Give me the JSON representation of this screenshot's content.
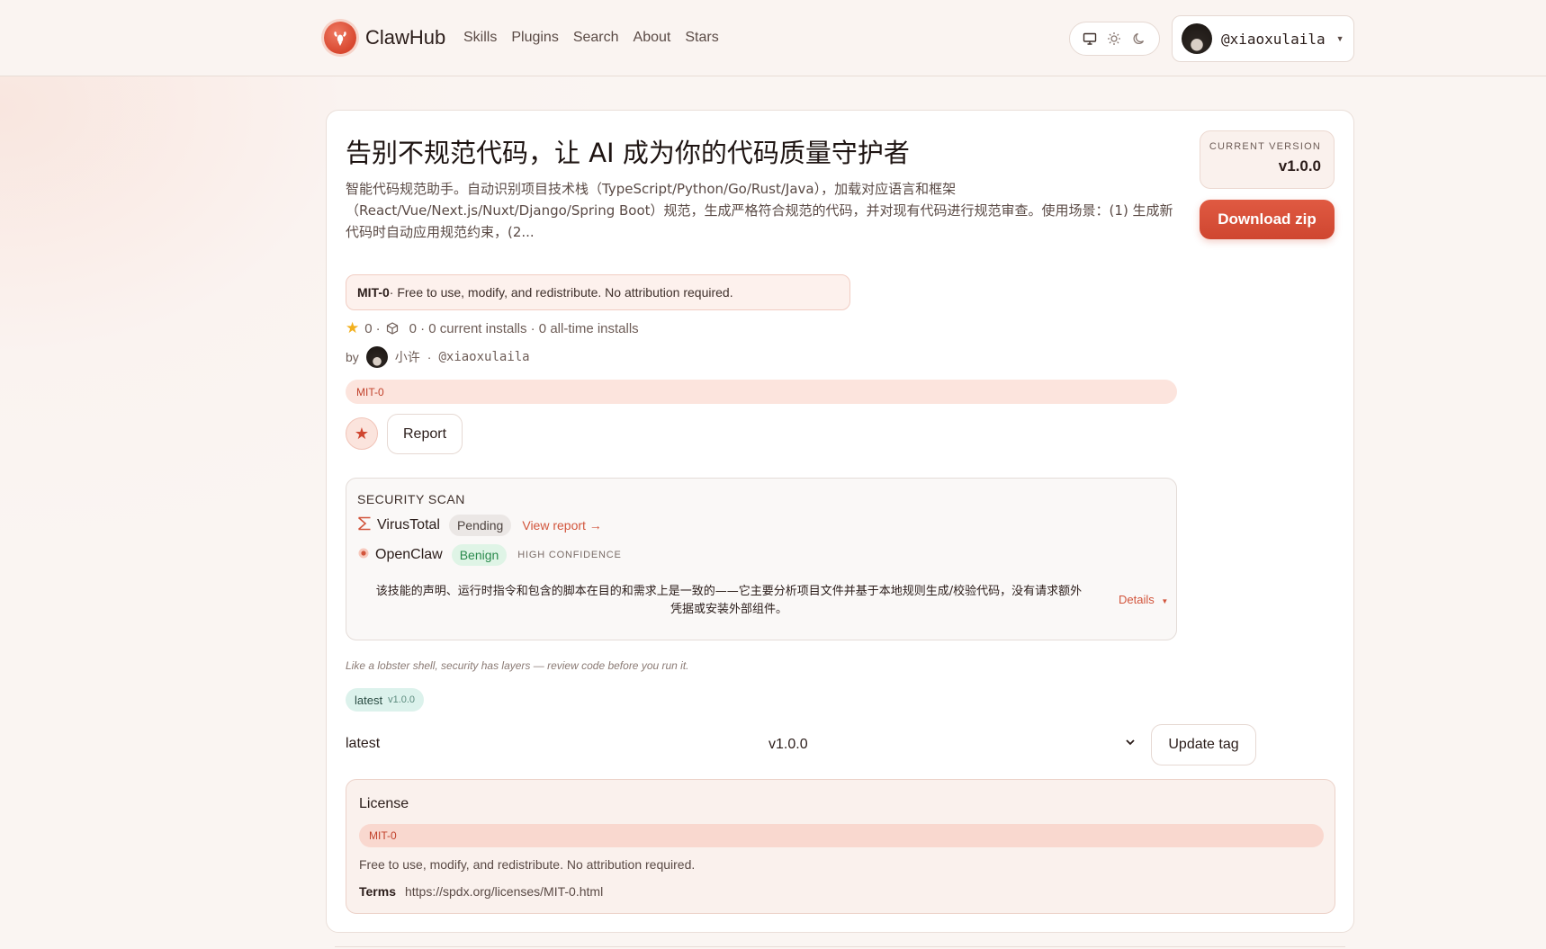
{
  "header": {
    "brand": "ClawHub",
    "nav": [
      "Skills",
      "Plugins",
      "Search",
      "About",
      "Stars"
    ],
    "user_handle": "@xiaoxulaila"
  },
  "skill": {
    "title": "告别不规范代码，让 AI 成为你的代码质量守护者",
    "summary": "智能代码规范助手。自动识别项目技术栈（TypeScript/Python/Go/Rust/Java），加载对应语言和框架（React/Vue/Next.js/Nuxt/Django/Spring Boot）规范，生成严格符合规范的代码，并对现有代码进行规范审查。使用场景：(1) 生成新代码时自动应用规范约束，(2...",
    "version_label": "CURRENT VERSION",
    "version": "v1.0.0",
    "download_label": "Download zip",
    "license_banner": {
      "id": "MIT-0",
      "text": " · Free to use, modify, and redistribute. No attribution required."
    },
    "stats": {
      "stars": "0",
      "stars_sep": "·",
      "installs": "0 · 0 current installs · 0 all-time installs"
    },
    "byline": {
      "by": "by",
      "author_name": "小许",
      "sep": "·",
      "author_handle": "@xiaoxulaila"
    },
    "license_pill": "MIT-0",
    "report_label": "Report"
  },
  "security_scan": {
    "title": "SECURITY SCAN",
    "virustotal": {
      "name": "VirusTotal",
      "status": "Pending",
      "link": "View report →"
    },
    "openclaw": {
      "name": "OpenClaw",
      "status": "Benign",
      "confidence": "HIGH CONFIDENCE"
    },
    "description": "该技能的声明、运行时指令和包含的脚本在目的和需求上是一致的——它主要分析项目文件并基于本地规则生成/校验代码，没有请求额外凭据或安装外部组件。",
    "details_label": "Details"
  },
  "tagline": "Like a lobster shell, security has layers — review code before you run it.",
  "tags": {
    "chip_name": "latest",
    "chip_version": "v1.0.0",
    "row_name": "latest",
    "selected_version": "v1.0.0",
    "update_label": "Update tag"
  },
  "license_panel": {
    "title": "License",
    "pill": "MIT-0",
    "description": "Free to use, modify, and redistribute. No attribution required.",
    "terms_label": "Terms",
    "terms_url": "https://spdx.org/licenses/MIT-0.html"
  },
  "colors": {
    "accent": "#cf4630",
    "benign": "#2a8a4c",
    "star": "#f2b01e"
  }
}
